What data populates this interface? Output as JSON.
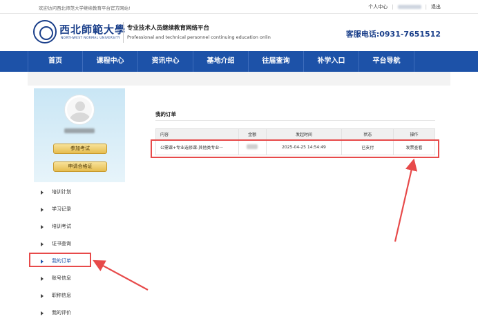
{
  "topbar": {
    "welcome": "欢迎访问西北师范大学继续教育平台官方网站!",
    "personal_center": "个人中心",
    "separator": "|",
    "logout": "退出"
  },
  "header": {
    "logo_cn": "西北師範大學",
    "logo_en": "NORTHWEST NORMAL UNIVERSITY",
    "site_title": "专业技术人员继续教育网络平台",
    "site_subtitle": "Professional and technical personnel continuing education onlin",
    "hotline": "客服电话:0931-7651512"
  },
  "nav": {
    "items": [
      "首页",
      "课程中心",
      "资讯中心",
      "基地介绍",
      "往届查询",
      "补学入口",
      "平台导航"
    ]
  },
  "sidebar": {
    "buttons": {
      "exam": "参加考试",
      "certificate": "申请合格证"
    },
    "menu": [
      "培训计划",
      "学习记录",
      "培训考试",
      "证书查询",
      "我的订单",
      "账号信息",
      "职称信息",
      "我的评价"
    ],
    "active_index": 4
  },
  "orders": {
    "title": "我的订单",
    "columns": [
      "内容",
      "金额",
      "发起时间",
      "状态",
      "操作"
    ],
    "rows": [
      {
        "content": "公需课+专业选修课-其他类专业···",
        "time": "2025-04-25 14:54:49",
        "status": "已支付",
        "action": "发票查看"
      }
    ]
  },
  "colors": {
    "nav_bg": "#1d52a8",
    "brand_blue": "#1a3f8a",
    "highlight_red": "#e74a4a",
    "paid_green": "#1b8a2a",
    "link_blue": "#1d64c8"
  }
}
